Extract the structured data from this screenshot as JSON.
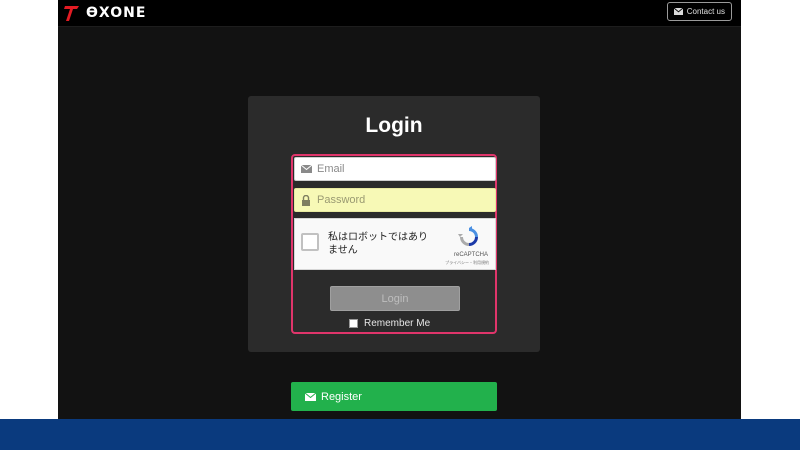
{
  "header": {
    "logo_text": "ƟXONE",
    "contact_label": "Contact us"
  },
  "login": {
    "title": "Login",
    "email_placeholder": "Email",
    "password_placeholder": "Password",
    "recaptcha": {
      "label": "私はロボットではありません",
      "brand": "reCAPTCHA",
      "links": "プライバシー・利用規約"
    },
    "login_button": "Login",
    "remember_label": "Remember Me"
  },
  "register": {
    "label": "Register"
  },
  "colors": {
    "page_bg": "#121212",
    "panel_bg": "#2b2b2b",
    "highlight_border": "#e0356b",
    "register_green": "#22b14c",
    "logo_red": "#e31b23",
    "bottom_band": "#0a3a7e",
    "password_autofill": "#f7f9b6"
  },
  "icons": {
    "logo": "exone-logo-icon",
    "contact": "envelope-icon",
    "email": "envelope-icon",
    "password": "lock-icon",
    "register": "envelope-icon",
    "recaptcha": "recaptcha-logo-icon"
  }
}
